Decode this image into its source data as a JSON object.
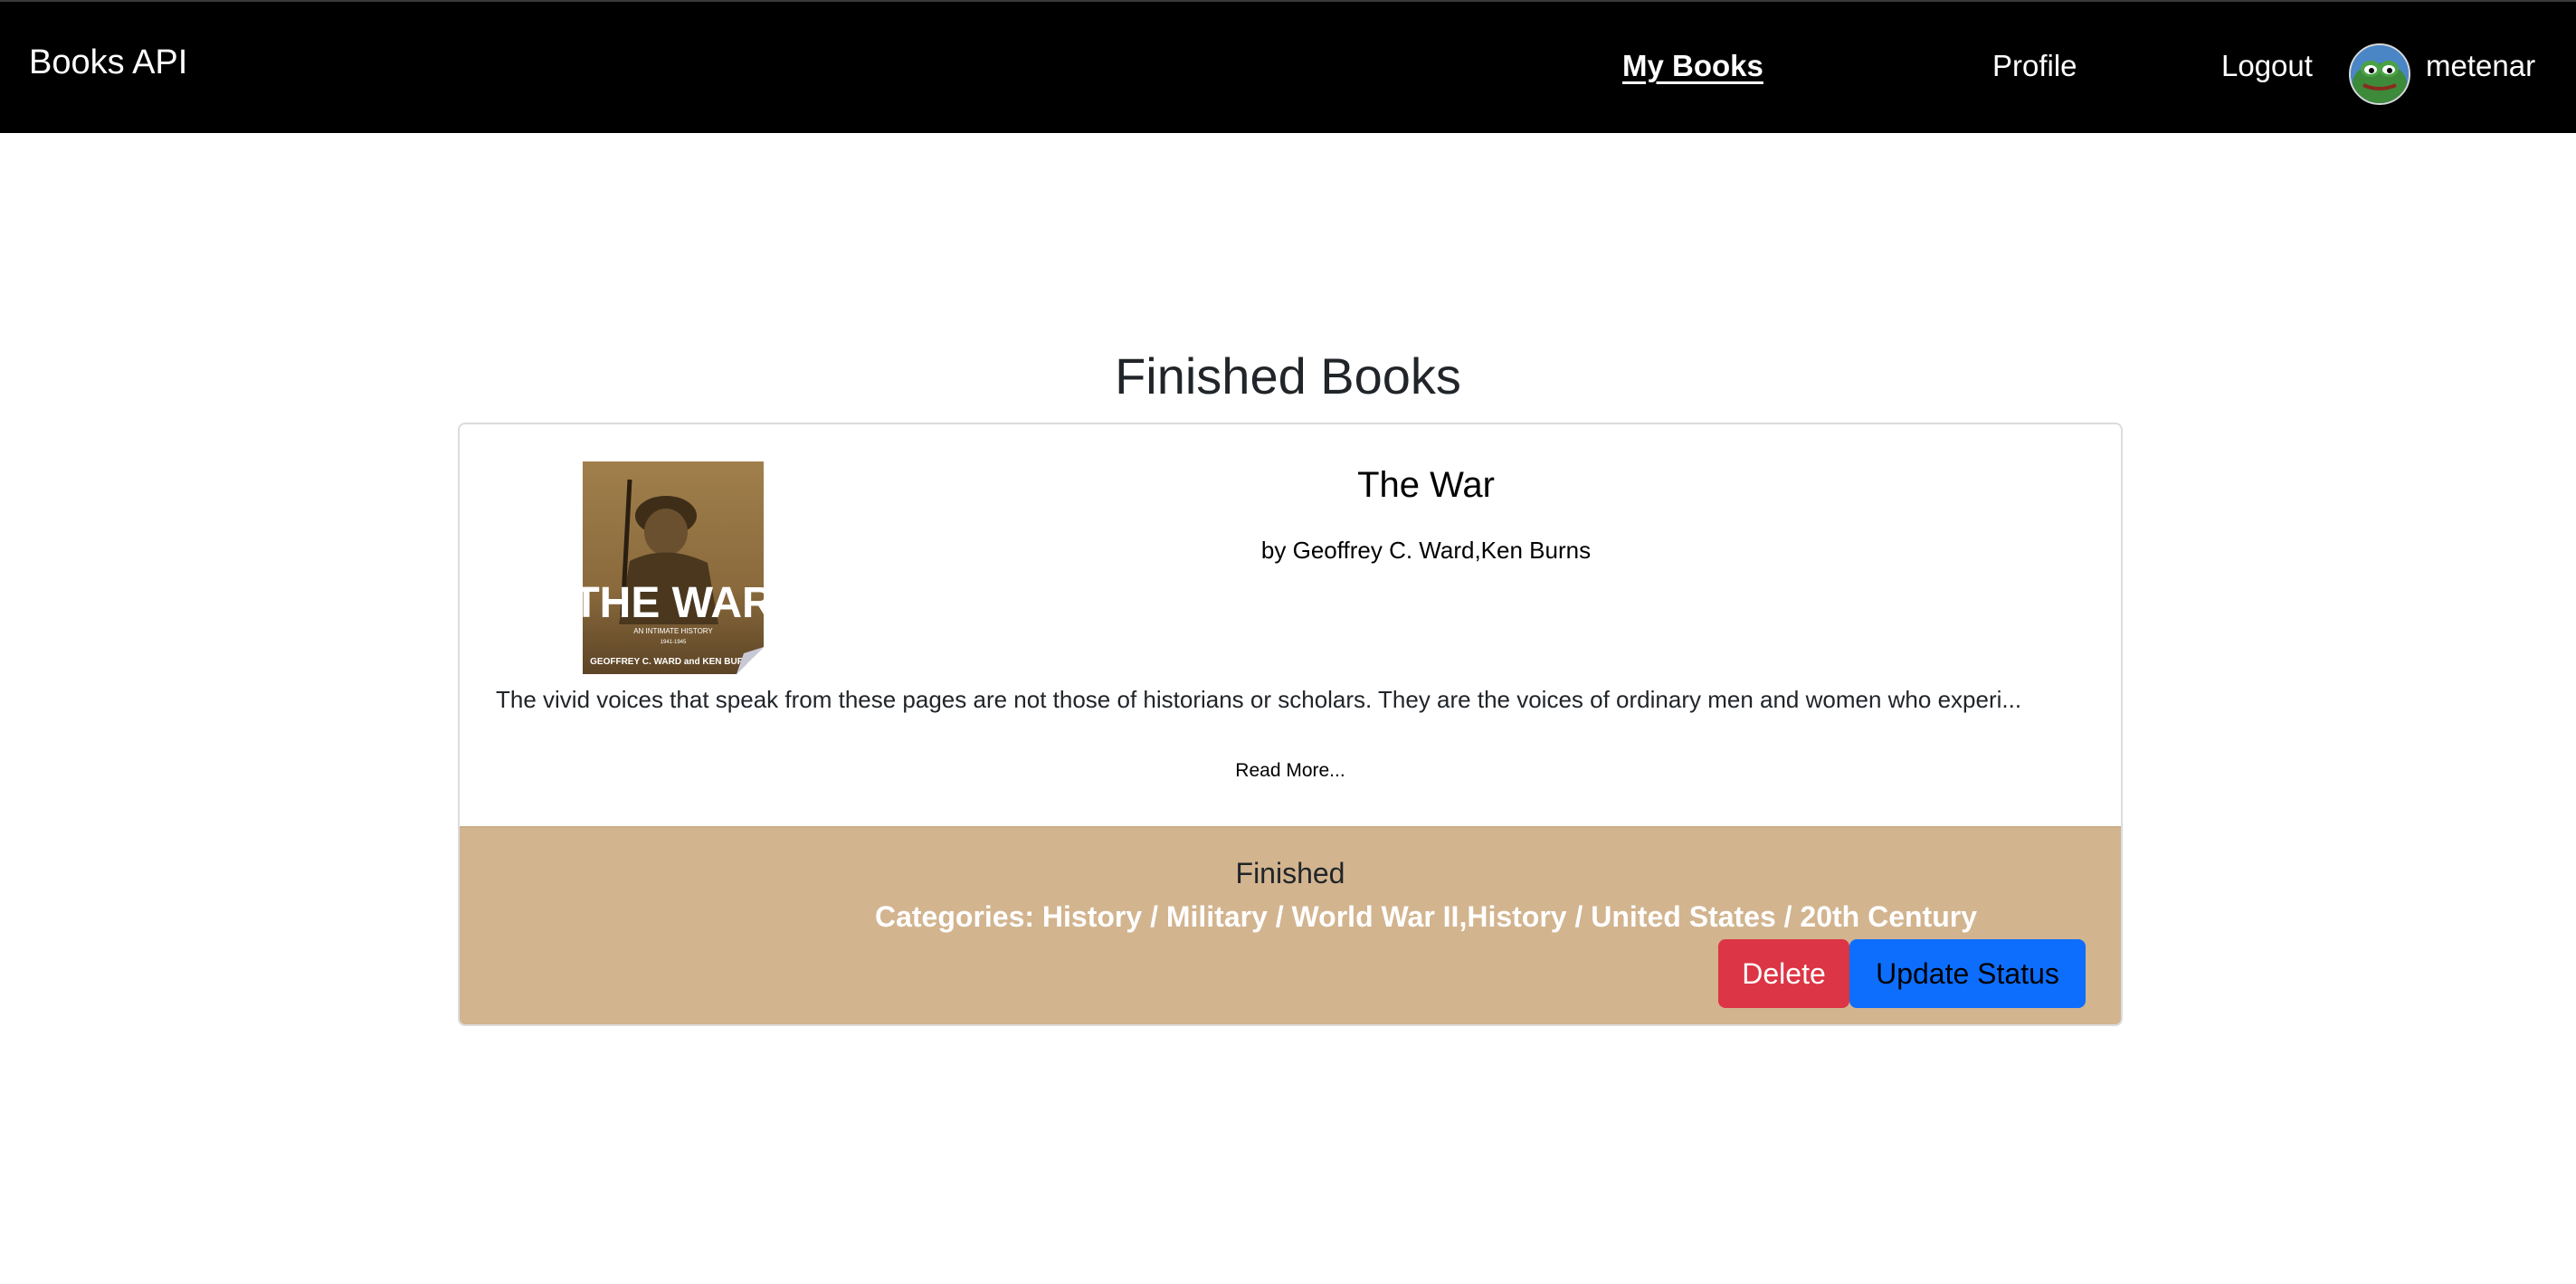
{
  "navbar": {
    "brand": "Books API",
    "links": [
      {
        "label": "My Books",
        "active": true
      },
      {
        "label": "Profile",
        "active": false
      },
      {
        "label": "Logout",
        "active": false
      }
    ],
    "username": "metenar"
  },
  "page": {
    "heading": "Finished Books"
  },
  "book": {
    "cover_text": {
      "title": "THE WAR",
      "subtitle": "AN INTIMATE HISTORY",
      "years": "1941-1945",
      "authors": "GEOFFREY C. WARD and KEN BURNS"
    },
    "title": "The War",
    "author": "by Geoffrey C. Ward,Ken Burns",
    "description": "The vivid voices that speak from these pages are not those of historians or scholars. They are the voices of ordinary men and women who experi...",
    "read_more": "Read More...",
    "status": "Finished",
    "categories": "Categories: History / Military / World War II,History / United States / 20th Century",
    "delete_label": "Delete",
    "update_label": "Update Status"
  },
  "colors": {
    "navbar_bg": "#000000",
    "footer_bg": "#d2b48f",
    "delete_bg": "#dc3545",
    "update_bg": "#0d6efd"
  }
}
